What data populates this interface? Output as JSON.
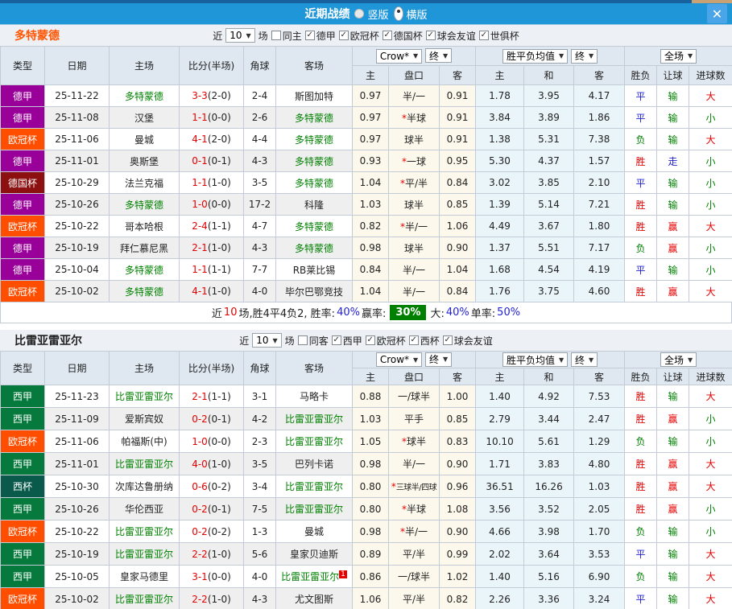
{
  "titlebar": {
    "title": "近期战绩",
    "radios": [
      {
        "label": "竖版",
        "selected": false
      },
      {
        "label": "横版",
        "selected": true
      }
    ],
    "close_label": "✕"
  },
  "table_header": {
    "col_type": "类型",
    "col_date": "日期",
    "col_home": "主场",
    "col_score": "比分(半场)",
    "col_corner": "角球",
    "col_away": "客场",
    "odds_company_select": "Crow*",
    "odds_final_select": "终",
    "avg_select": "胜平负均值",
    "avg_final_select": "终",
    "scope_select": "全场",
    "sub_odds_home": "主",
    "sub_odds_handicap": "盘口",
    "sub_odds_away": "客",
    "sub_avg_home": "主",
    "sub_avg_draw": "和",
    "sub_avg_away": "客",
    "col_result": "胜负",
    "col_handicap_result": "让球",
    "col_goals": "进球数"
  },
  "colors": {
    "titlebar_bg": "#1f96d8",
    "close_bg": "#4aa5e8",
    "filter_row_bg": "#edf1f6",
    "header_bg": "#dfe8f1",
    "row_alt_bg": "#efefef",
    "odds_col_bg": "#fdf8ec",
    "avg_col_bg": "#eaf5fa",
    "focus_team": "#008000",
    "score_red": "#e60000",
    "team1_title": "#ff5500",
    "league_colors": {
      "德甲": "#990099",
      "欧冠杯": "#ff4e00",
      "德国杯": "#8c1010",
      "西甲": "#067a3c",
      "西杯": "#0a5a4c"
    },
    "result_colors": {
      "胜": "#e60000",
      "平": "#2222cc",
      "负": "#008000",
      "赢": "#e60000",
      "走": "#2222cc",
      "输": "#008000",
      "大": "#e60000",
      "小": "#008000"
    }
  },
  "sections": [
    {
      "team": "多特蒙德",
      "team_style": "orange",
      "filter": {
        "prefix": "近",
        "count": "10",
        "suffix": "场",
        "checkboxes": [
          {
            "label": "同主",
            "checked": false
          },
          {
            "label": "德甲",
            "checked": true
          },
          {
            "label": "欧冠杯",
            "checked": true
          },
          {
            "label": "德国杯",
            "checked": true
          },
          {
            "label": "球会友谊",
            "checked": true
          },
          {
            "label": "世俱杯",
            "checked": true
          }
        ]
      },
      "rows": [
        {
          "league": "德甲",
          "date": "25-11-22",
          "home": "多特蒙德",
          "home_focus": true,
          "score": "3-3",
          "half": "(2-0)",
          "corner": "2-4",
          "away": "斯图加特",
          "away_focus": false,
          "odds": [
            "0.97",
            "半/一",
            "0.91"
          ],
          "avg": [
            "1.78",
            "3.95",
            "4.17"
          ],
          "results": [
            "平",
            "输",
            "大"
          ]
        },
        {
          "league": "德甲",
          "date": "25-11-08",
          "home": "汉堡",
          "home_focus": false,
          "score": "1-1",
          "half": "(0-0)",
          "corner": "2-6",
          "away": "多特蒙德",
          "away_focus": true,
          "odds": [
            "0.97",
            "*半球",
            "0.91"
          ],
          "avg": [
            "3.84",
            "3.89",
            "1.86"
          ],
          "results": [
            "平",
            "输",
            "小"
          ]
        },
        {
          "league": "欧冠杯",
          "date": "25-11-06",
          "home": "曼城",
          "home_focus": false,
          "score": "4-1",
          "half": "(2-0)",
          "corner": "4-4",
          "away": "多特蒙德",
          "away_focus": true,
          "odds": [
            "0.97",
            "球半",
            "0.91"
          ],
          "avg": [
            "1.38",
            "5.31",
            "7.38"
          ],
          "results": [
            "负",
            "输",
            "大"
          ]
        },
        {
          "league": "德甲",
          "date": "25-11-01",
          "home": "奥斯堡",
          "home_focus": false,
          "score": "0-1",
          "half": "(0-1)",
          "corner": "4-3",
          "away": "多特蒙德",
          "away_focus": true,
          "odds": [
            "0.93",
            "*一球",
            "0.95"
          ],
          "avg": [
            "5.30",
            "4.37",
            "1.57"
          ],
          "results": [
            "胜",
            "走",
            "小"
          ]
        },
        {
          "league": "德国杯",
          "date": "25-10-29",
          "home": "法兰克福",
          "home_focus": false,
          "score": "1-1",
          "half": "(1-0)",
          "corner": "3-5",
          "away": "多特蒙德",
          "away_focus": true,
          "odds": [
            "1.04",
            "*平/半",
            "0.84"
          ],
          "avg": [
            "3.02",
            "3.85",
            "2.10"
          ],
          "results": [
            "平",
            "输",
            "小"
          ]
        },
        {
          "league": "德甲",
          "date": "25-10-26",
          "home": "多特蒙德",
          "home_focus": true,
          "score": "1-0",
          "half": "(0-0)",
          "corner": "17-2",
          "away": "科隆",
          "away_focus": false,
          "odds": [
            "1.03",
            "球半",
            "0.85"
          ],
          "avg": [
            "1.39",
            "5.14",
            "7.21"
          ],
          "results": [
            "胜",
            "输",
            "小"
          ]
        },
        {
          "league": "欧冠杯",
          "date": "25-10-22",
          "home": "哥本哈根",
          "home_focus": false,
          "score": "2-4",
          "half": "(1-1)",
          "corner": "4-7",
          "away": "多特蒙德",
          "away_focus": true,
          "odds": [
            "0.82",
            "*半/一",
            "1.06"
          ],
          "avg": [
            "4.49",
            "3.67",
            "1.80"
          ],
          "results": [
            "胜",
            "赢",
            "大"
          ]
        },
        {
          "league": "德甲",
          "date": "25-10-19",
          "home": "拜仁慕尼黑",
          "home_focus": false,
          "score": "2-1",
          "half": "(1-0)",
          "corner": "4-3",
          "away": "多特蒙德",
          "away_focus": true,
          "odds": [
            "0.98",
            "球半",
            "0.90"
          ],
          "avg": [
            "1.37",
            "5.51",
            "7.17"
          ],
          "results": [
            "负",
            "赢",
            "小"
          ]
        },
        {
          "league": "德甲",
          "date": "25-10-04",
          "home": "多特蒙德",
          "home_focus": true,
          "score": "1-1",
          "half": "(1-1)",
          "corner": "7-7",
          "away": "RB莱比锡",
          "away_focus": false,
          "odds": [
            "0.84",
            "半/一",
            "1.04"
          ],
          "avg": [
            "1.68",
            "4.54",
            "4.19"
          ],
          "results": [
            "平",
            "输",
            "小"
          ]
        },
        {
          "league": "欧冠杯",
          "date": "25-10-02",
          "home": "多特蒙德",
          "home_focus": true,
          "score": "4-1",
          "half": "(1-0)",
          "corner": "4-0",
          "away": "毕尔巴鄂竞技",
          "away_focus": false,
          "odds": [
            "1.04",
            "半/一",
            "0.84"
          ],
          "avg": [
            "1.76",
            "3.75",
            "4.60"
          ],
          "results": [
            "胜",
            "赢",
            "大"
          ]
        }
      ],
      "summary": [
        {
          "text": "近",
          "style": "black"
        },
        {
          "text": "10",
          "style": "red"
        },
        {
          "text": "场,胜4平4负2, 胜率:",
          "style": "black"
        },
        {
          "text": "40%",
          "style": "blue"
        },
        {
          "text": " 赢率:",
          "style": "black"
        },
        {
          "text": "30%",
          "style": "greenbox"
        },
        {
          "text": " 大:",
          "style": "black"
        },
        {
          "text": "40%",
          "style": "blue"
        },
        {
          "text": " 单率:",
          "style": "black"
        },
        {
          "text": "50%",
          "style": "blue"
        }
      ]
    },
    {
      "team": "比雷亚雷亚尔",
      "team_style": "dark",
      "filter": {
        "prefix": "近",
        "count": "10",
        "suffix": "场",
        "checkboxes": [
          {
            "label": "同客",
            "checked": false
          },
          {
            "label": "西甲",
            "checked": true
          },
          {
            "label": "欧冠杯",
            "checked": true
          },
          {
            "label": "西杯",
            "checked": true
          },
          {
            "label": "球会友谊",
            "checked": true
          }
        ]
      },
      "rows": [
        {
          "league": "西甲",
          "date": "25-11-23",
          "home": "比雷亚雷亚尔",
          "home_focus": true,
          "score": "2-1",
          "half": "(1-1)",
          "corner": "3-1",
          "away": "马略卡",
          "away_focus": false,
          "odds": [
            "0.88",
            "一/球半",
            "1.00"
          ],
          "avg": [
            "1.40",
            "4.92",
            "7.53"
          ],
          "results": [
            "胜",
            "输",
            "大"
          ]
        },
        {
          "league": "西甲",
          "date": "25-11-09",
          "home": "爱斯宾奴",
          "home_focus": false,
          "score": "0-2",
          "half": "(0-1)",
          "corner": "4-2",
          "away": "比雷亚雷亚尔",
          "away_focus": true,
          "odds": [
            "1.03",
            "平手",
            "0.85"
          ],
          "avg": [
            "2.79",
            "3.44",
            "2.47"
          ],
          "results": [
            "胜",
            "赢",
            "小"
          ]
        },
        {
          "league": "欧冠杯",
          "date": "25-11-06",
          "home": "帕福斯(中)",
          "home_focus": false,
          "score": "1-0",
          "half": "(0-0)",
          "corner": "2-3",
          "away": "比雷亚雷亚尔",
          "away_focus": true,
          "odds": [
            "1.05",
            "*球半",
            "0.83"
          ],
          "avg": [
            "10.10",
            "5.61",
            "1.29"
          ],
          "results": [
            "负",
            "输",
            "小"
          ]
        },
        {
          "league": "西甲",
          "date": "25-11-01",
          "home": "比雷亚雷亚尔",
          "home_focus": true,
          "score": "4-0",
          "half": "(1-0)",
          "corner": "3-5",
          "away": "巴列卡诺",
          "away_focus": false,
          "odds": [
            "0.98",
            "半/一",
            "0.90"
          ],
          "avg": [
            "1.71",
            "3.83",
            "4.80"
          ],
          "results": [
            "胜",
            "赢",
            "大"
          ]
        },
        {
          "league": "西杯",
          "date": "25-10-30",
          "home": "次库达鲁册纳",
          "home_focus": false,
          "score": "0-6",
          "half": "(0-2)",
          "corner": "3-4",
          "away": "比雷亚雷亚尔",
          "away_focus": true,
          "odds": [
            "0.80",
            "*三球半/四球",
            "0.96"
          ],
          "avg": [
            "36.51",
            "16.26",
            "1.03"
          ],
          "results": [
            "胜",
            "赢",
            "大"
          ]
        },
        {
          "league": "西甲",
          "date": "25-10-26",
          "home": "华伦西亚",
          "home_focus": false,
          "score": "0-2",
          "half": "(0-1)",
          "corner": "7-5",
          "away": "比雷亚雷亚尔",
          "away_focus": true,
          "odds": [
            "0.80",
            "*半球",
            "1.08"
          ],
          "avg": [
            "3.56",
            "3.52",
            "2.05"
          ],
          "results": [
            "胜",
            "赢",
            "小"
          ]
        },
        {
          "league": "欧冠杯",
          "date": "25-10-22",
          "home": "比雷亚雷亚尔",
          "home_focus": true,
          "score": "0-2",
          "half": "(0-2)",
          "corner": "1-3",
          "away": "曼城",
          "away_focus": false,
          "odds": [
            "0.98",
            "*半/一",
            "0.90"
          ],
          "avg": [
            "4.66",
            "3.98",
            "1.70"
          ],
          "results": [
            "负",
            "输",
            "小"
          ]
        },
        {
          "league": "西甲",
          "date": "25-10-19",
          "home": "比雷亚雷亚尔",
          "home_focus": true,
          "score": "2-2",
          "half": "(1-0)",
          "corner": "5-6",
          "away": "皇家贝迪斯",
          "away_focus": false,
          "odds": [
            "0.89",
            "平/半",
            "0.99"
          ],
          "avg": [
            "2.02",
            "3.64",
            "3.53"
          ],
          "results": [
            "平",
            "输",
            "大"
          ]
        },
        {
          "league": "西甲",
          "date": "25-10-05",
          "home": "皇家马德里",
          "home_focus": false,
          "score": "3-1",
          "half": "(0-0)",
          "corner": "4-0",
          "away": "比雷亚雷亚尔",
          "away_focus": true,
          "away_badge": "1",
          "odds": [
            "0.86",
            "一/球半",
            "1.02"
          ],
          "avg": [
            "1.40",
            "5.16",
            "6.90"
          ],
          "results": [
            "负",
            "输",
            "大"
          ]
        },
        {
          "league": "欧冠杯",
          "date": "25-10-02",
          "home": "比雷亚雷亚尔",
          "home_focus": true,
          "score": "2-2",
          "half": "(1-0)",
          "corner": "4-3",
          "away": "尤文图斯",
          "away_focus": false,
          "odds": [
            "1.06",
            "平/半",
            "0.82"
          ],
          "avg": [
            "2.26",
            "3.36",
            "3.24"
          ],
          "results": [
            "平",
            "输",
            "大"
          ]
        }
      ],
      "summary": null
    }
  ]
}
